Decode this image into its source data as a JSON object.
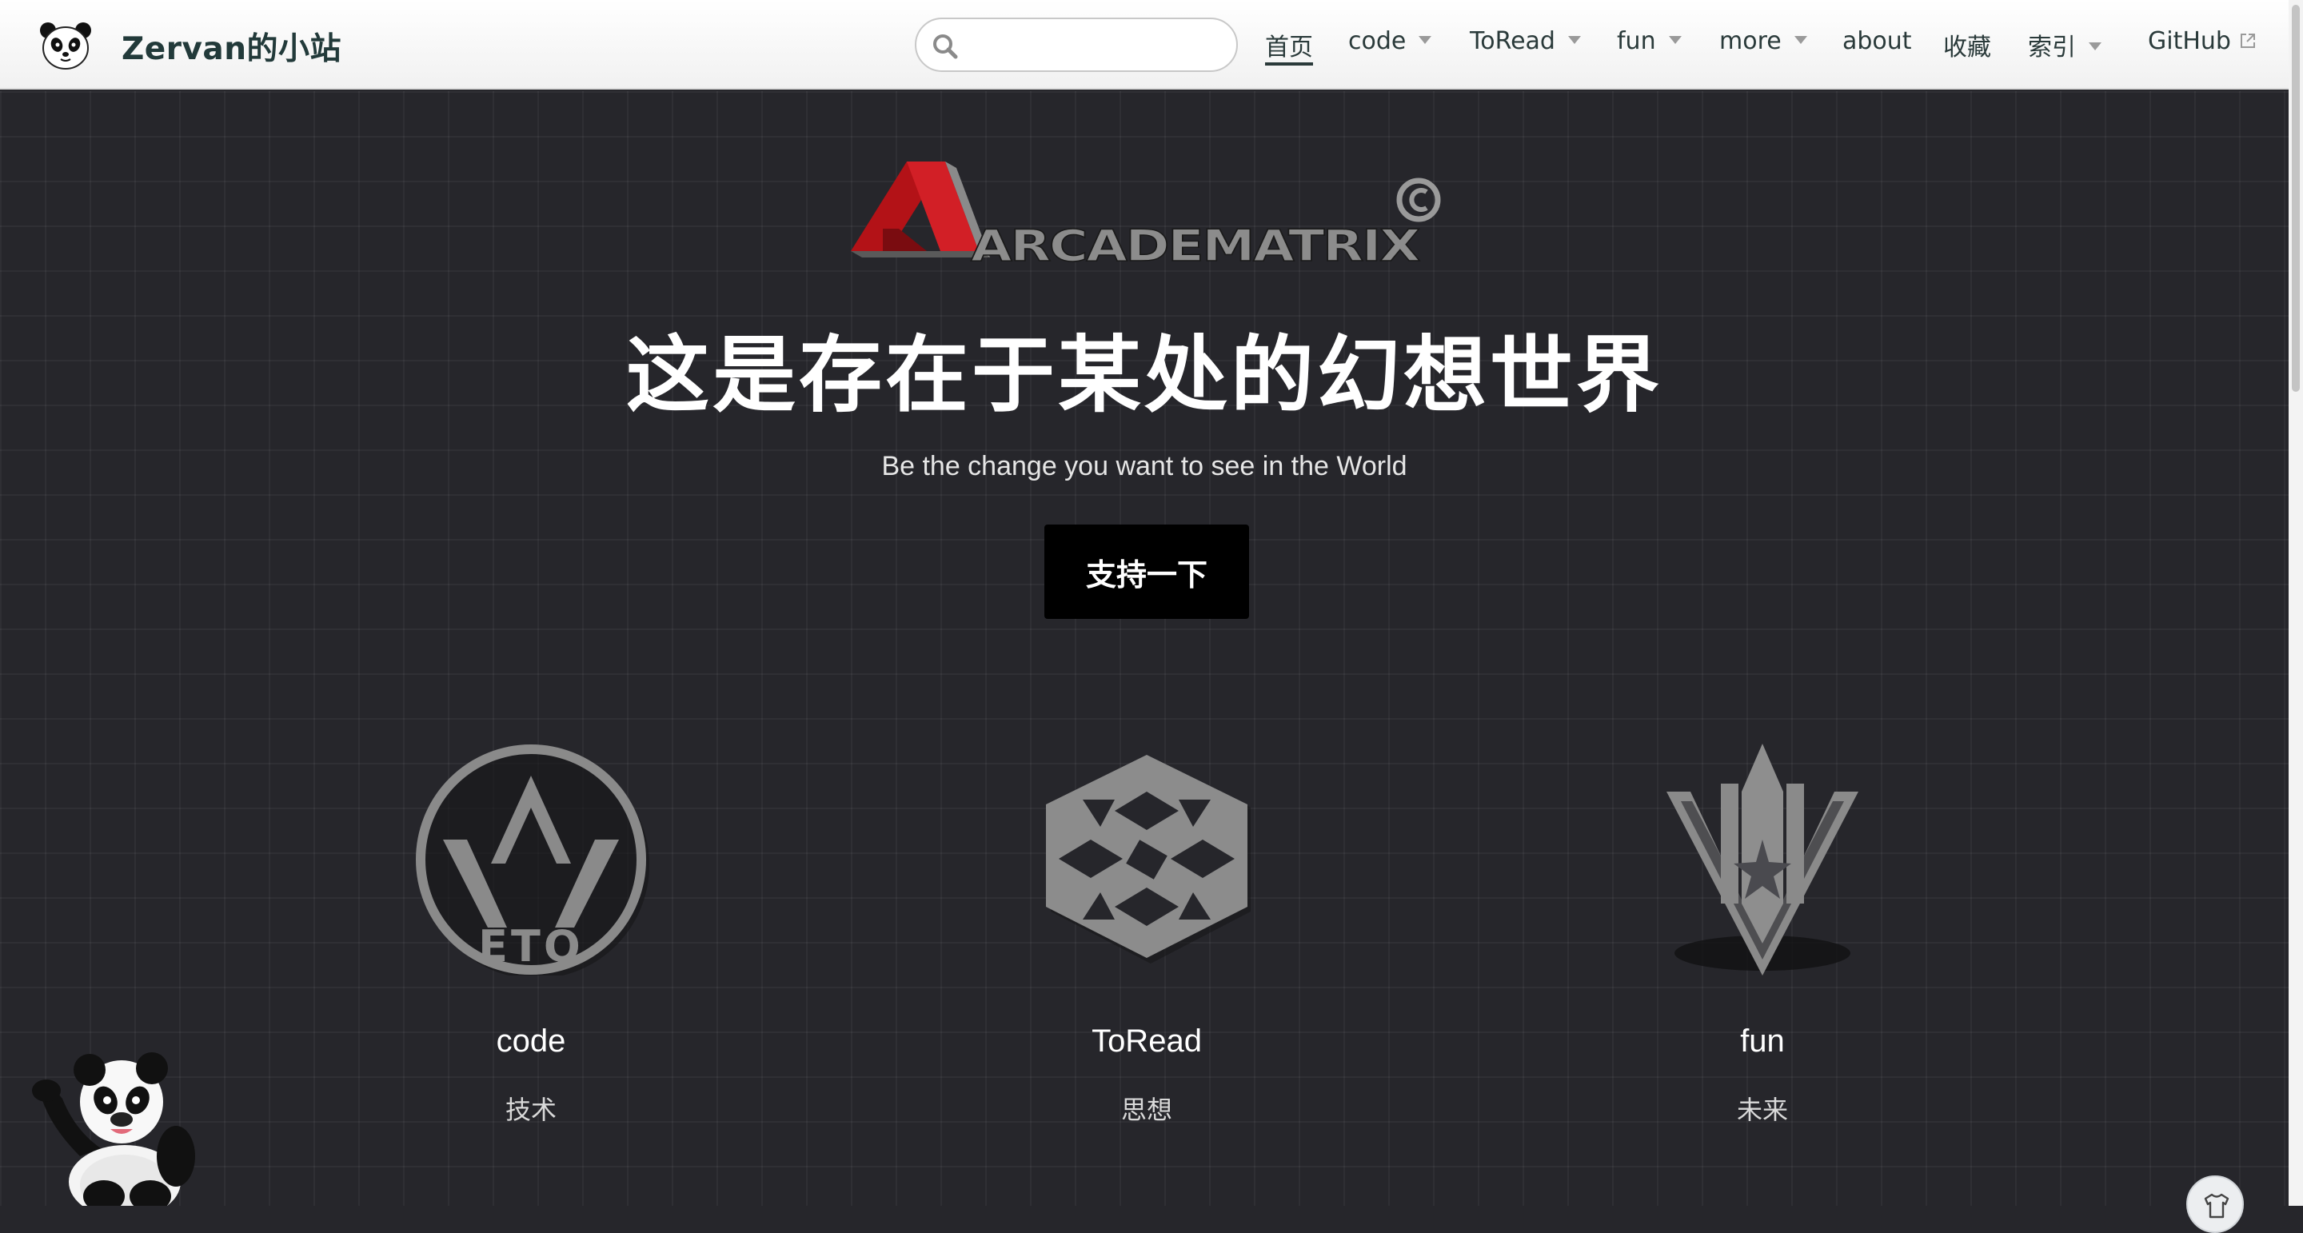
{
  "site": {
    "title": "Zervan的小站"
  },
  "search": {
    "placeholder": "",
    "value": ""
  },
  "nav": [
    {
      "label": "首页",
      "dropdown": false,
      "active": true
    },
    {
      "label": "code",
      "dropdown": true
    },
    {
      "label": "ToRead",
      "dropdown": true
    },
    {
      "label": "fun",
      "dropdown": true
    },
    {
      "label": "more",
      "dropdown": true
    },
    {
      "label": "about",
      "dropdown": false
    },
    {
      "label": "收藏",
      "dropdown": false
    },
    {
      "label": "索引",
      "dropdown": true
    },
    {
      "label": "GitHub",
      "dropdown": false,
      "external": true
    }
  ],
  "hero": {
    "brand_text": "ARCADEMATRIX",
    "title": "这是存在于某处的幻想世界",
    "subtitle": "Be the change you want to see in the World",
    "cta_label": "支持一下"
  },
  "features": [
    {
      "title": "code",
      "desc": "技术",
      "icon": "eto-circle-icon"
    },
    {
      "title": "ToRead",
      "desc": "思想",
      "icon": "hexagon-knot-icon"
    },
    {
      "title": "fun",
      "desc": "未来",
      "icon": "shield-emblem-icon"
    }
  ],
  "colors": {
    "accent": "#000000",
    "background": "#26262b",
    "brand_red": "#c4161c"
  }
}
